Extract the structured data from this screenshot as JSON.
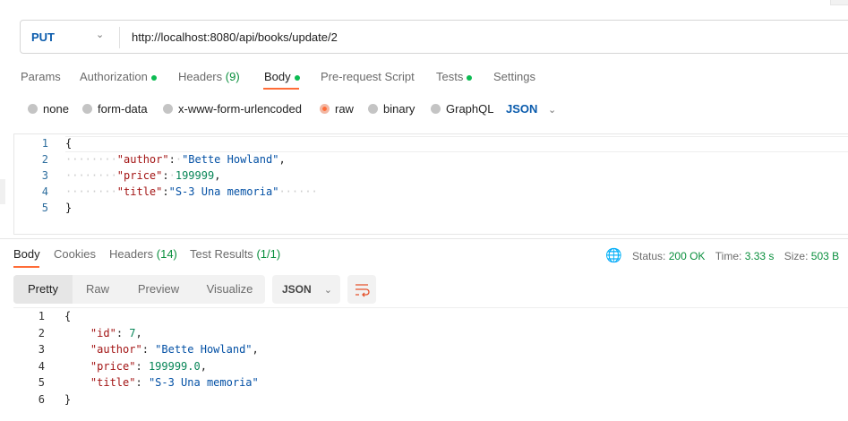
{
  "request": {
    "method": "PUT",
    "url": "http://localhost:8080/api/books/update/2"
  },
  "req_tabs": {
    "params": "Params",
    "authorization": "Authorization",
    "headers": "Headers",
    "headers_count": "(9)",
    "body": "Body",
    "prerequest": "Pre-request Script",
    "tests": "Tests",
    "settings": "Settings"
  },
  "body_types": {
    "none": "none",
    "form_data": "form-data",
    "urlencoded": "x-www-form-urlencoded",
    "raw": "raw",
    "binary": "binary",
    "graphql": "GraphQL",
    "language": "JSON"
  },
  "request_body": {
    "line_numbers": [
      "1",
      "2",
      "3",
      "4",
      "5"
    ],
    "open": "{",
    "close": "}",
    "author_key": "\"author\"",
    "author_val": "\"Bette Howland\"",
    "price_key": "\"price\"",
    "price_val": "199999",
    "title_key": "\"title\"",
    "title_val": "\"S-3 Una memoria\""
  },
  "resp_tabs": {
    "body": "Body",
    "cookies": "Cookies",
    "headers": "Headers",
    "headers_count": "(14)",
    "tests": "Test Results",
    "tests_count": "(1/1)"
  },
  "status": {
    "status_label": "Status:",
    "status": "200 OK",
    "time_label": "Time:",
    "time": "3.33 s",
    "size_label": "Size:",
    "size": "503 B"
  },
  "view_modes": {
    "pretty": "Pretty",
    "raw": "Raw",
    "preview": "Preview",
    "visualize": "Visualize",
    "format": "JSON"
  },
  "response_body": {
    "line_numbers": [
      "1",
      "2",
      "3",
      "4",
      "5",
      "6"
    ],
    "open": "{",
    "close": "}",
    "id_key": "\"id\"",
    "id_val": "7",
    "author_key": "\"author\"",
    "author_val": "\"Bette Howland\"",
    "price_key": "\"price\"",
    "price_val": "199999.0",
    "title_key": "\"title\"",
    "title_val": "\"S-3 Una memoria\""
  }
}
